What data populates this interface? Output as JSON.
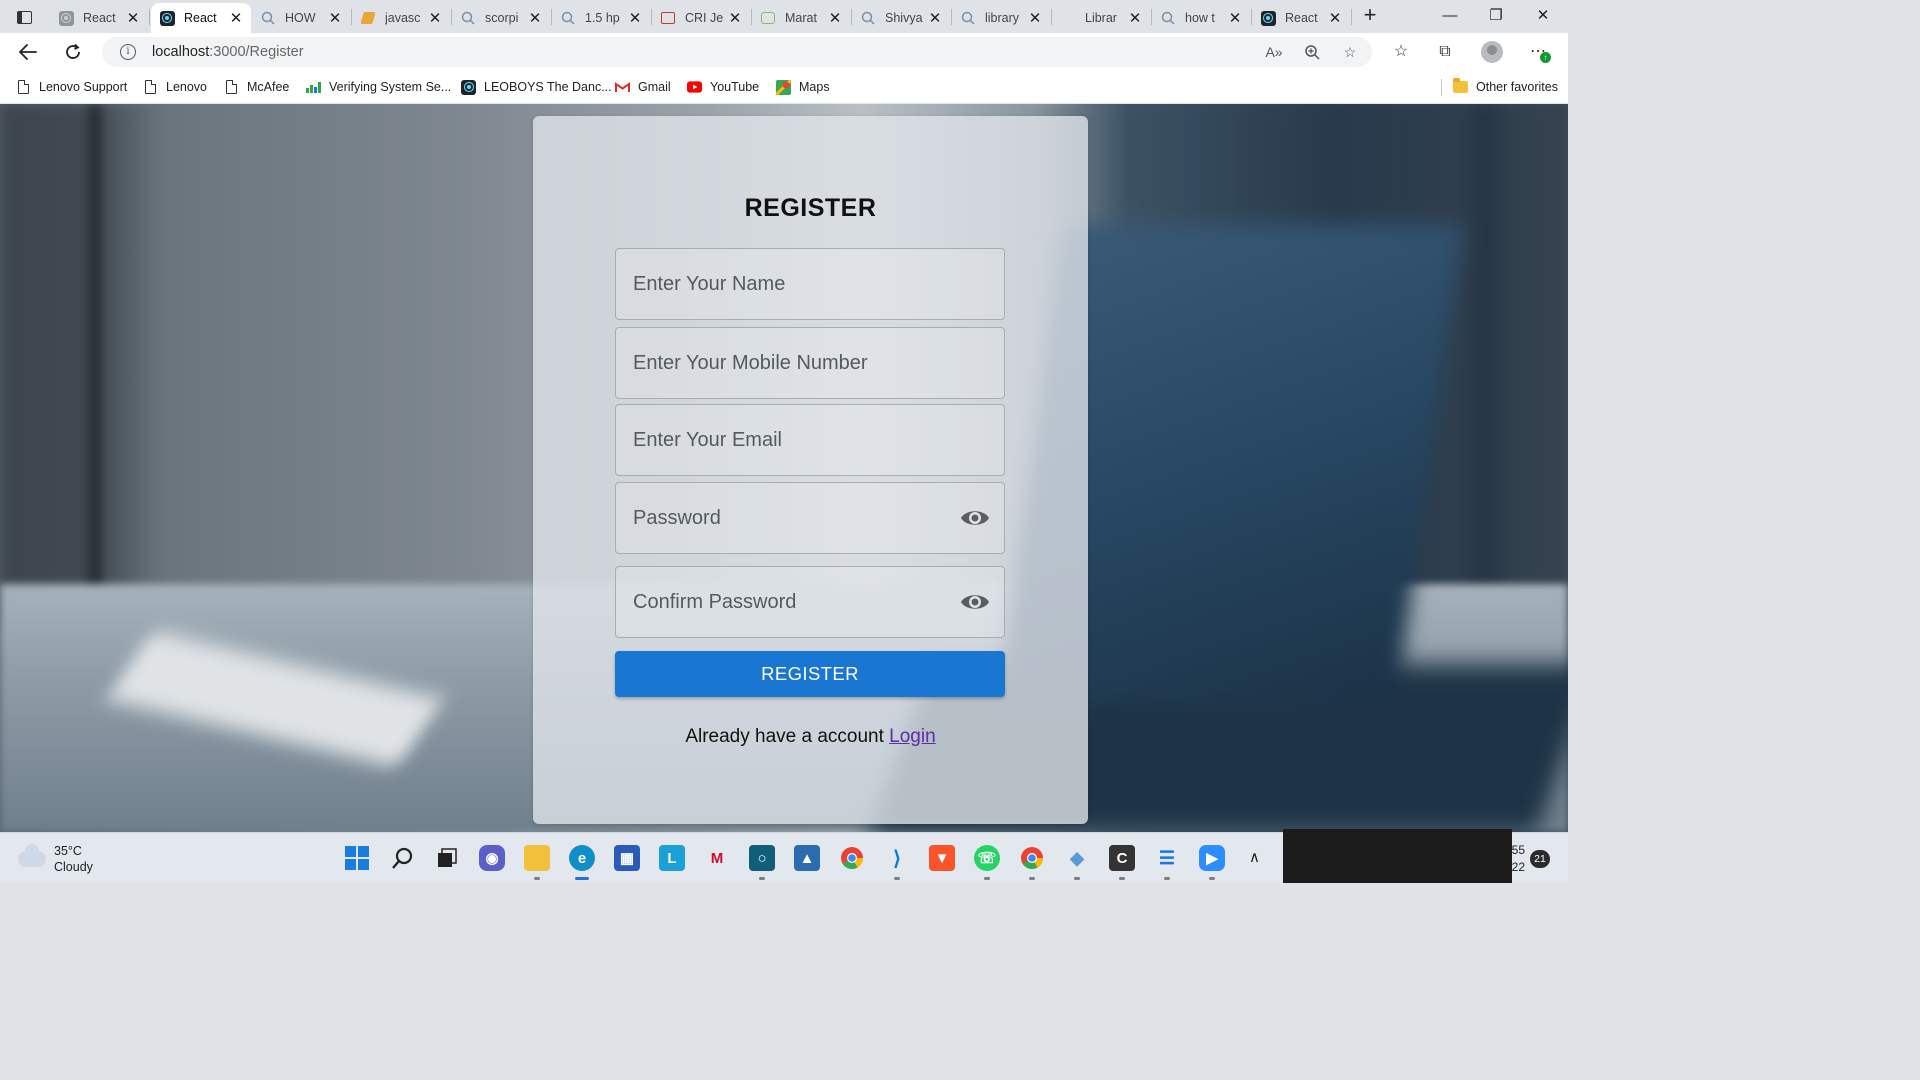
{
  "browser": {
    "tabs": [
      {
        "title": "React",
        "favicon": "react-icon-grey",
        "active": false
      },
      {
        "title": "React",
        "favicon": "react-icon",
        "active": true
      },
      {
        "title": "HOW",
        "favicon": "search-icon",
        "active": false
      },
      {
        "title": "javasc",
        "favicon": "js-icon",
        "active": false
      },
      {
        "title": "scorpi",
        "favicon": "search-icon",
        "active": false
      },
      {
        "title": "1.5 hp",
        "favicon": "search-icon",
        "active": false
      },
      {
        "title": "CRI Je",
        "favicon": "cri-icon",
        "active": false
      },
      {
        "title": "Marat",
        "favicon": "marathi-icon",
        "active": false
      },
      {
        "title": "Shivya",
        "favicon": "search-icon",
        "active": false
      },
      {
        "title": "library",
        "favicon": "search-icon",
        "active": false
      },
      {
        "title": "Librar",
        "favicon": "",
        "active": false
      },
      {
        "title": "how t",
        "favicon": "search-icon",
        "active": false
      },
      {
        "title": "React",
        "favicon": "react-icon",
        "active": false
      }
    ],
    "address": {
      "host": "localhost",
      "path": ":3000/Register"
    },
    "bookmarks": [
      {
        "label": "Lenovo Support",
        "icon": "page-icon"
      },
      {
        "label": "Lenovo",
        "icon": "page-icon"
      },
      {
        "label": "McAfee",
        "icon": "page-icon"
      },
      {
        "label": "Verifying System Se...",
        "icon": "chart-icon"
      },
      {
        "label": "LEOBOYS The Danc...",
        "icon": "react-icon"
      },
      {
        "label": "Gmail",
        "icon": "gmail-icon"
      },
      {
        "label": "YouTube",
        "icon": "youtube-icon"
      },
      {
        "label": "Maps",
        "icon": "maps-icon"
      }
    ],
    "other_favorites": "Other favorites"
  },
  "form": {
    "title": "REGISTER",
    "name_placeholder": "Enter Your Name",
    "mobile_placeholder": "Enter Your Mobile Number",
    "email_placeholder": "Enter Your Email",
    "password_placeholder": "Password",
    "confirm_placeholder": "Confirm Password",
    "submit_label": "REGISTER",
    "login_prompt": "Already have a account",
    "login_link": "Login"
  },
  "taskbar": {
    "weather_temp": "35°C",
    "weather_desc": "Cloudy",
    "clock_time": "55",
    "clock_date": "22",
    "notification_count": "21"
  },
  "colors": {
    "primary_button": "#1976d2",
    "login_link": "#5a2ea6",
    "tab_strip": "#dfe3e8"
  }
}
